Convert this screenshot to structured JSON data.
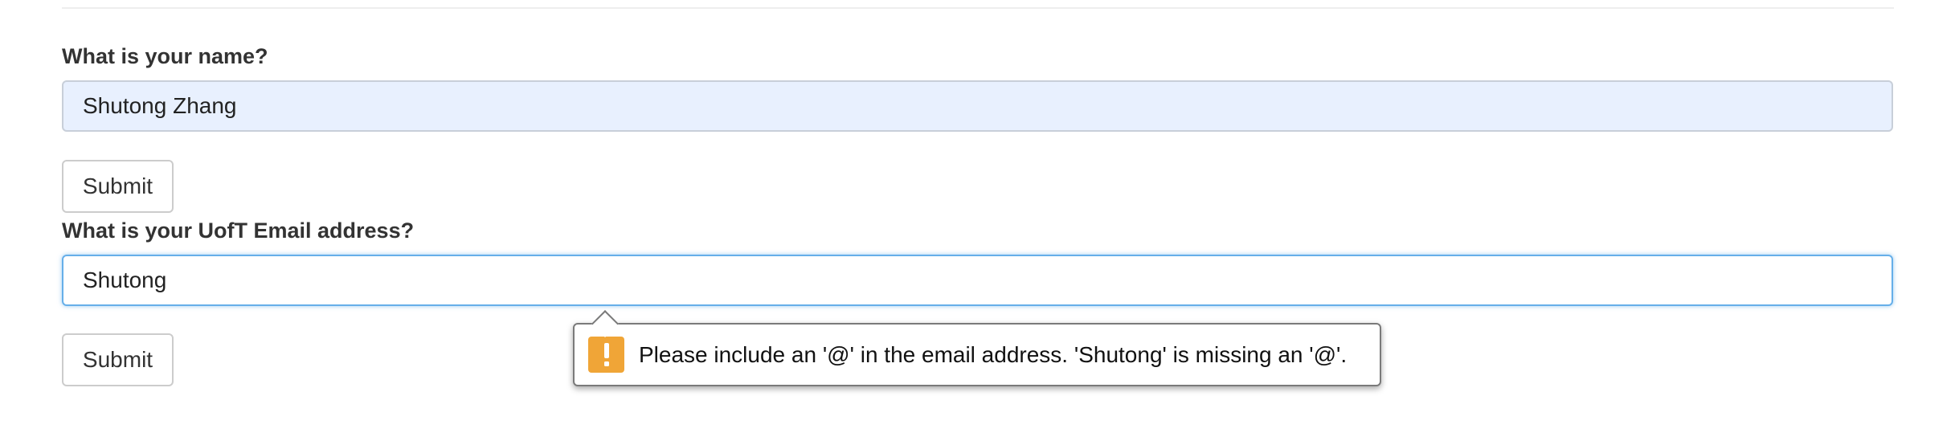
{
  "form": {
    "name_question": {
      "label": "What is your name?",
      "value": "Shutong Zhang",
      "submit_label": "Submit"
    },
    "email_question": {
      "label": "What is your UofT Email address?",
      "value": "Shutong",
      "submit_label": "Submit"
    }
  },
  "validation_tooltip": {
    "icon": "warning-icon",
    "message": "Please include an '@' in the email address. 'Shutong' is missing an '@'.",
    "icon_color": "#f0a537"
  },
  "colors": {
    "autofill_background": "#e8f0fe",
    "focus_border": "#66afe9"
  }
}
